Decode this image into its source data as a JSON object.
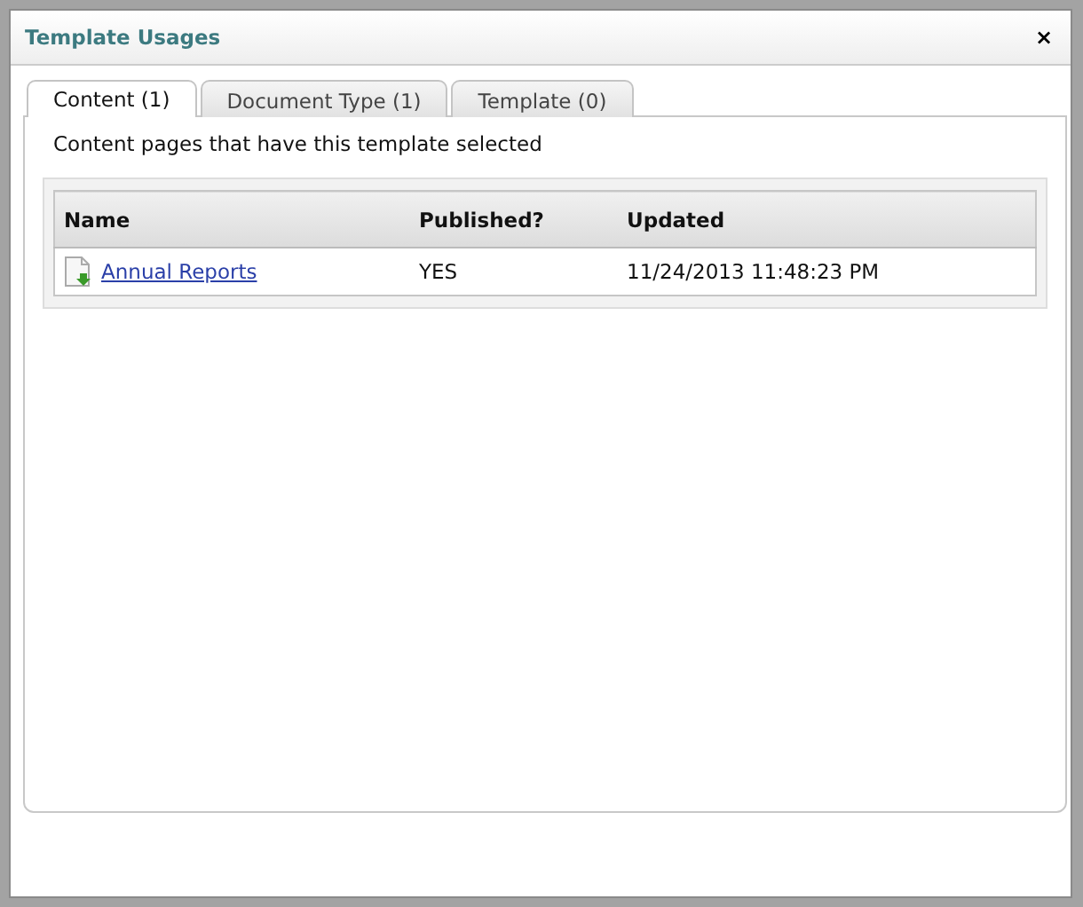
{
  "window": {
    "title": "Template Usages",
    "close": "×"
  },
  "tabs": [
    {
      "label": "Content (1)",
      "selected": true
    },
    {
      "label": "Document Type (1)",
      "selected": false
    },
    {
      "label": "Template (0)",
      "selected": false
    }
  ],
  "description": "Content pages that have this template selected",
  "table": {
    "columns": [
      "Name",
      "Published?",
      "Updated"
    ],
    "rows": [
      {
        "name": "Annual Reports",
        "published": "YES",
        "updated": "11/24/2013 11:48:23 PM"
      }
    ]
  }
}
